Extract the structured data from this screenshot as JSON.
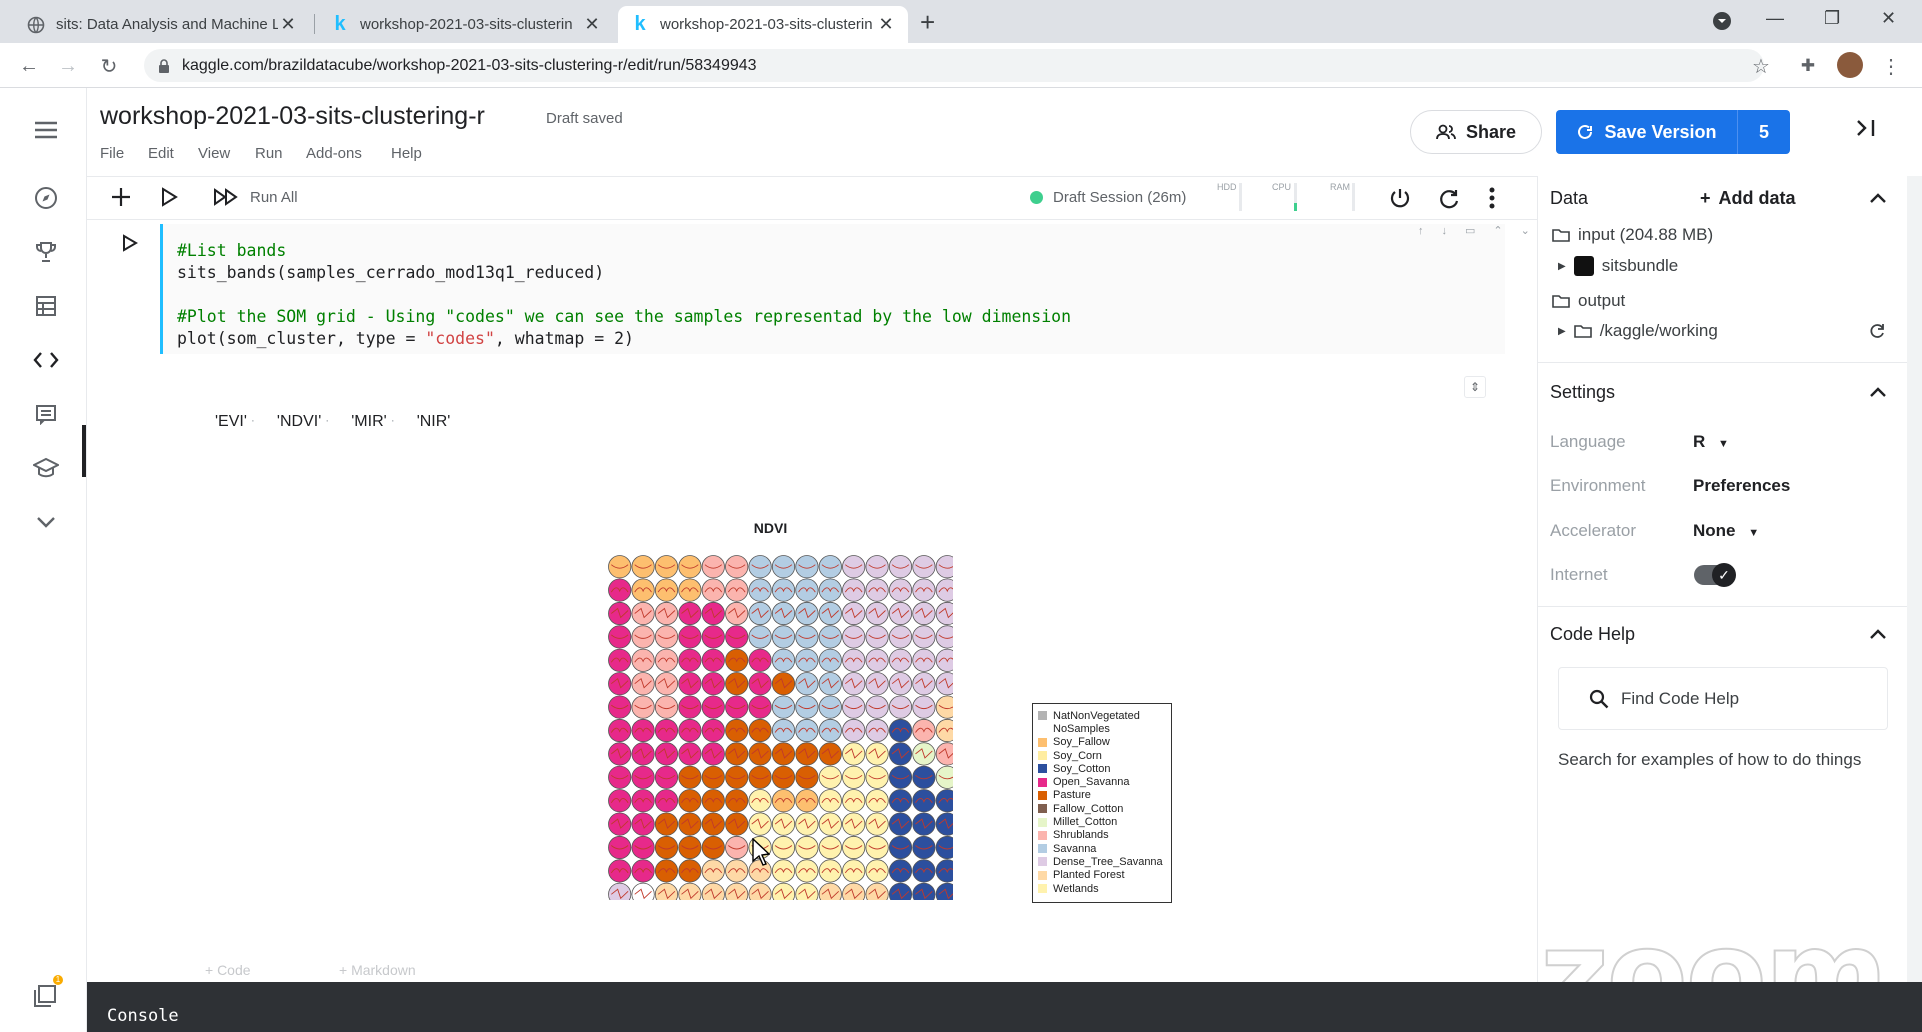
{
  "browser": {
    "tabs": [
      {
        "title": "sits: Data Analysis and Machine L"
      },
      {
        "title": "workshop-2021-03-sits-clusterin"
      },
      {
        "title": "workshop-2021-03-sits-clusterin"
      }
    ],
    "url": "kaggle.com/brazildatacube/workshop-2021-03-sits-clustering-r/edit/run/58349943"
  },
  "header": {
    "title": "workshop-2021-03-sits-clustering-r",
    "status": "Draft saved",
    "menus": [
      "File",
      "Edit",
      "View",
      "Run",
      "Add-ons",
      "Help"
    ],
    "share_label": "Share",
    "save_label": "Save Version",
    "save_count": "5"
  },
  "toolbar": {
    "run_all": "Run All",
    "session": "Draft Session (26m)",
    "meters": [
      "HDD",
      "CPU",
      "RAM"
    ]
  },
  "cell": {
    "lines": [
      {
        "parts": [
          {
            "t": "#List bands",
            "c": "cm"
          }
        ]
      },
      {
        "parts": [
          {
            "t": "sits_bands(samples_cerrado_mod13q1_reduced)",
            "c": ""
          }
        ]
      },
      {
        "parts": [
          {
            "t": "",
            "c": ""
          }
        ]
      },
      {
        "parts": [
          {
            "t": "#Plot the SOM grid - Using \"codes\" we can see the samples representad by the low dimension",
            "c": "cm"
          }
        ]
      },
      {
        "parts": [
          {
            "t": "plot(som_cluster, type = ",
            "c": ""
          },
          {
            "t": "\"codes\"",
            "c": "st"
          },
          {
            "t": ", whatmap = 2)",
            "c": ""
          }
        ]
      }
    ]
  },
  "output": {
    "bands": [
      "'EVI'",
      "'NDVI'",
      "'MIR'",
      "'NIR'"
    ],
    "plot_title": "NDVI"
  },
  "legend": [
    {
      "label": "NatNonVegetated",
      "color": "#b3b3b3"
    },
    {
      "label": "NoSamples",
      "color": "#ffffff"
    },
    {
      "label": "Soy_Fallow",
      "color": "#fdbf6f"
    },
    {
      "label": "Soy_Corn",
      "color": "#ffeda0"
    },
    {
      "label": "Soy_Cotton",
      "color": "#2c4f9e"
    },
    {
      "label": "Open_Savanna",
      "color": "#e7298a"
    },
    {
      "label": "Pasture",
      "color": "#d95f02"
    },
    {
      "label": "Fallow_Cotton",
      "color": "#7f5f4f"
    },
    {
      "label": "Millet_Cotton",
      "color": "#e6f5c9"
    },
    {
      "label": "Shrublands",
      "color": "#fbb4ae"
    },
    {
      "label": "Savanna",
      "color": "#b3cde3"
    },
    {
      "label": "Dense_Tree_Savanna",
      "color": "#decbe4"
    },
    {
      "label": "Planted Forest",
      "color": "#fed9a6"
    },
    {
      "label": "Wetlands",
      "color": "#fff2ae"
    }
  ],
  "som_grid": {
    "rows": 15,
    "cols": 15,
    "classes": [
      "FFFFBBSSSSDDDDD",
      "OFFFBBSSSSDDDDD",
      "OBBOOBSSSSDDDDD",
      "OBBOOOSSSSDDDDD",
      "OBBOOPOSSSDDDDD",
      "OBBOOPOPSSDDDDD",
      "OBBOOOOSSSDDDDY",
      "OOOOOPPSSSDDCBY",
      "OOOOOPPPPPWWCMB",
      "OOOPPPPPPWWWCCM",
      "OOOPPPWFFWWWCCC",
      "OOPPPPWWWWWWCCC",
      "OOPPPBWWWWWWCCC",
      "OOPPYYYWWWWWCCC",
      "DNYYYYYWWYYYCCC"
    ],
    "class_key": {
      "F": "Soy_Fallow",
      "B": "Shrublands",
      "S": "Savanna",
      "D": "Dense_Tree_Savanna",
      "O": "Open_Savanna",
      "P": "Pasture",
      "W": "Wetlands",
      "Y": "Planted Forest",
      "C": "Soy_Cotton",
      "M": "Millet_Cotton",
      "N": "NoSamples"
    }
  },
  "add_cell": {
    "code": "+ Code",
    "markdown": "+ Markdown"
  },
  "right_panel": {
    "data_title": "Data",
    "add_data": "Add data",
    "input": "input (204.88 MB)",
    "dataset": "sitsbundle",
    "output": "output",
    "working": "/kaggle/working",
    "settings_title": "Settings",
    "settings": [
      {
        "label": "Language",
        "value": "R"
      },
      {
        "label": "Environment",
        "value": "Preferences"
      },
      {
        "label": "Accelerator",
        "value": "None"
      },
      {
        "label": "Internet",
        "value": ""
      }
    ],
    "code_help_title": "Code Help",
    "find_placeholder": "Find Code Help",
    "help_text": "Search for examples of how to do things"
  },
  "watermark": "zoom",
  "console_label": "Console",
  "notification_count": "1"
}
